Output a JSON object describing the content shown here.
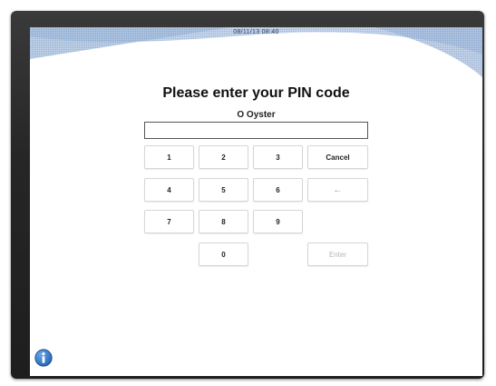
{
  "header": {
    "datetime": "08/11/13 08:40"
  },
  "title": "Please enter your PIN code",
  "user_name": "O Oyster",
  "pin_input": {
    "value": "",
    "placeholder": ""
  },
  "keypad": {
    "k1": "1",
    "k2": "2",
    "k3": "3",
    "k4": "4",
    "k5": "5",
    "k6": "6",
    "k7": "7",
    "k8": "8",
    "k9": "9",
    "k0": "0",
    "cancel": "Cancel",
    "backspace": "←",
    "enter": "Enter"
  },
  "icons": {
    "info": "info-icon"
  },
  "colors": {
    "info_blue": "#1f5fb0",
    "header_wave": "#a9c1dd"
  }
}
